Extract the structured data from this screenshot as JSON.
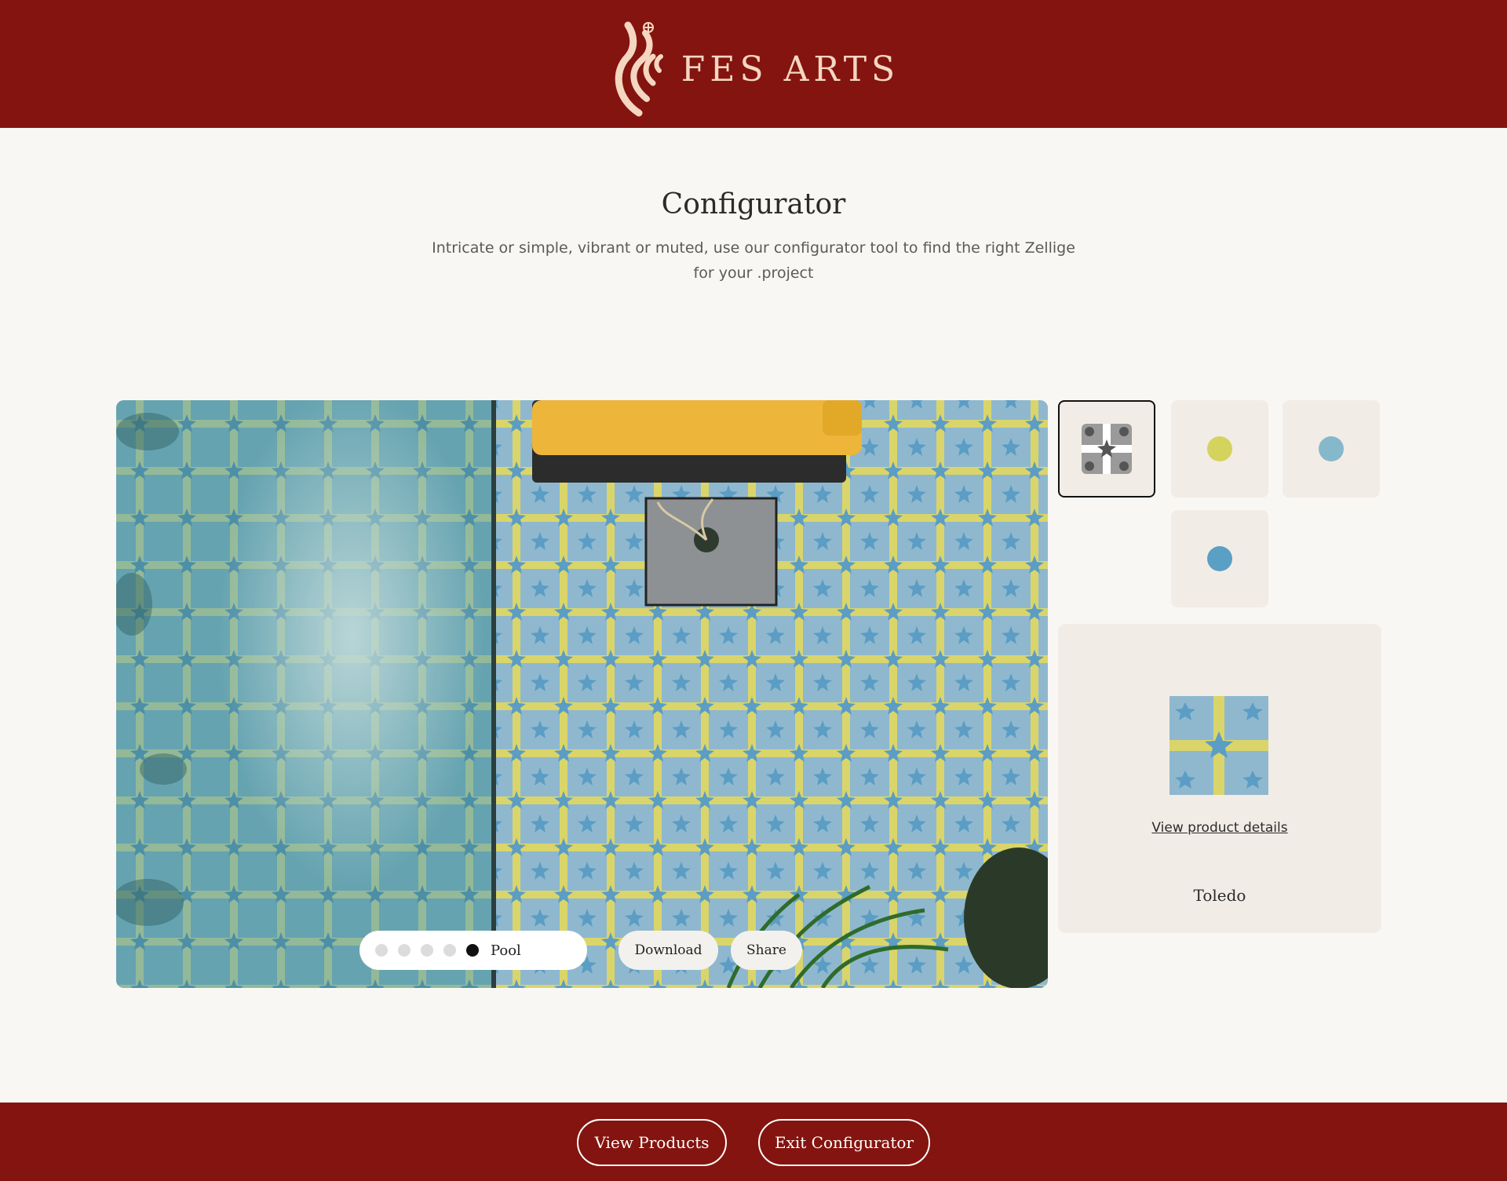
{
  "header": {
    "brand": "FES ARTS",
    "logo_icon": "calligraphy-flame-logo",
    "background": "#84140f",
    "brand_color": "#f4d6c1"
  },
  "intro": {
    "title": "Configurator",
    "subtitle": "Intricate or simple, vibrant or muted, use our configurator tool to find the right Zellige for your .project"
  },
  "preview": {
    "scene_label": "Pool",
    "scene_count": 5,
    "active_scene_index": 4,
    "download_label": "Download",
    "share_label": "Share"
  },
  "swatches": [
    {
      "name": "pattern",
      "icon": "tile-pattern-icon",
      "selected": true
    },
    {
      "name": "yellow",
      "color": "#d3d35e",
      "selected": false
    },
    {
      "name": "light-blue",
      "color": "#86b8cc",
      "selected": false
    },
    {
      "name": "blue",
      "color": "#5a9fc4",
      "selected": false
    }
  ],
  "product": {
    "link_label": "View product details",
    "name": "Toledo"
  },
  "footer": {
    "view_products_label": "View Products",
    "exit_label": "Exit Configurator",
    "background": "#84140f"
  }
}
